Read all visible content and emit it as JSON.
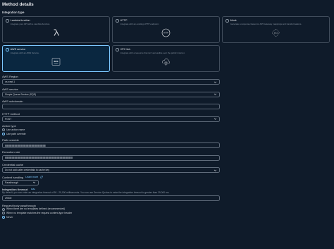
{
  "page": {
    "title": "Method details"
  },
  "integration": {
    "label": "Integration type",
    "cards": [
      {
        "title": "Lambda function",
        "desc": "Integrate your API with a Lambda function.",
        "icon": "lambda-icon",
        "selected": false
      },
      {
        "title": "HTTP",
        "desc": "Integrate with an existing HTTP endpoint.",
        "icon": "http-icon",
        "selected": false
      },
      {
        "title": "Mock",
        "desc": "Generate a response based on API Gateway mappings and transformations.",
        "icon": "mock-icon",
        "selected": false
      },
      {
        "title": "AWS service",
        "desc": "Integrate with an AWS Service.",
        "icon": "aws-icon",
        "selected": true
      },
      {
        "title": "VPC link",
        "desc": "Integrate with a resource that isn't accessible over the public internet.",
        "icon": "vpc-link-icon",
        "selected": false
      }
    ]
  },
  "fields": {
    "region_label": "AWS Region",
    "region_value": "us-east-1",
    "service_label": "AWS service",
    "service_value": "Simple Queue Service (SQS)",
    "subdomain_label": "AWS subdomain",
    "subdomain_value": "",
    "method_label": "HTTP method",
    "method_value": "POST",
    "action_type_label": "Action type",
    "action_type_options": [
      "Use action name",
      "Use path override"
    ],
    "action_type_selected": 1,
    "path_override_label": "Path override",
    "execution_role_label": "Execution role",
    "credential_cache_label": "Credential cache",
    "credential_cache_value": "Do not add caller credentials to cache key",
    "content_handling_label": "Content handling",
    "content_handling_link": "Learn more",
    "content_handling_value": "Passthrough",
    "timeout_label": "Integration timeout",
    "timeout_info": "Info",
    "timeout_hint": "By default, you can enter an integration timeout of 50 - 29,000 milliseconds. You can use Service Quotas to raise the integration timeout to greater than 29,000 ms.",
    "timeout_value": "29000",
    "passthrough_label": "Request body passthrough",
    "passthrough_options": [
      "When there are no templates defined (recommended)",
      "When no template matches the request content-type header",
      "Never"
    ],
    "passthrough_selected": 2
  },
  "colors": {
    "background": "#0f1b2a",
    "accent": "#7dc8ff",
    "border": "#5f6b7a",
    "text": "#d1d5db"
  }
}
